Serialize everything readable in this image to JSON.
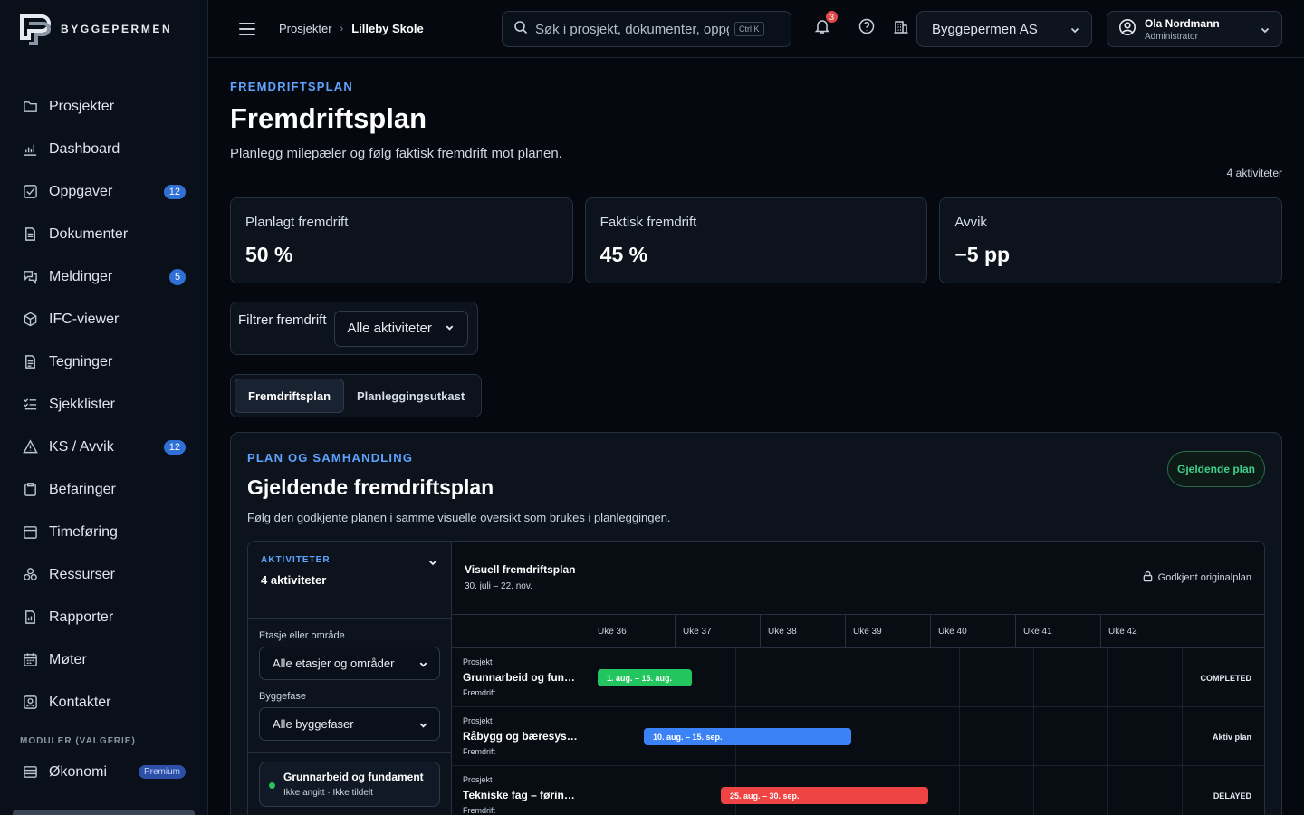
{
  "brand": {
    "name": "BYGGEPERMEN"
  },
  "sidebar": {
    "items": [
      {
        "label": "Prosjekter",
        "icon": "folder-icon"
      },
      {
        "label": "Dashboard",
        "icon": "chart-icon"
      },
      {
        "label": "Oppgaver",
        "icon": "checkbox-icon",
        "badge": "12"
      },
      {
        "label": "Dokumenter",
        "icon": "document-icon"
      },
      {
        "label": "Meldinger",
        "icon": "messages-icon",
        "badge": "5"
      },
      {
        "label": "IFC-viewer",
        "icon": "cube-icon"
      },
      {
        "label": "Tegninger",
        "icon": "drawing-icon"
      },
      {
        "label": "Sjekklister",
        "icon": "checklist-icon"
      },
      {
        "label": "KS / Avvik",
        "icon": "warning-icon",
        "badge": "12"
      },
      {
        "label": "Befaringer",
        "icon": "clipboard-icon"
      },
      {
        "label": "Timeføring",
        "icon": "timesheet-icon"
      },
      {
        "label": "Ressurser",
        "icon": "resources-icon"
      },
      {
        "label": "Rapporter",
        "icon": "report-icon"
      },
      {
        "label": "Møter",
        "icon": "calendar-icon"
      },
      {
        "label": "Kontakter",
        "icon": "contacts-icon"
      }
    ],
    "modules_label": "MODULER (VALGFRIE)",
    "modules": [
      {
        "label": "Økonomi",
        "icon": "economy-icon",
        "tag": "Premium"
      }
    ]
  },
  "topbar": {
    "breadcrumb": [
      "Prosjekter",
      "Lilleby Skole"
    ],
    "search_placeholder": "Søk i prosjekt, dokumenter, oppgaver...",
    "search_shortcut": "Ctrl K",
    "notifications": "3",
    "company": "Byggepermen AS",
    "user_name": "Ola Nordmann",
    "user_role": "Administrator"
  },
  "page": {
    "eyebrow": "FREMDRIFTSPLAN",
    "title": "Fremdriftsplan",
    "subtitle": "Planlegg milepæler og følg faktisk fremdrift mot planen.",
    "activity_count": "4 aktiviteter",
    "stats": [
      {
        "label": "Planlagt fremdrift",
        "value": "50 %"
      },
      {
        "label": "Faktisk fremdrift",
        "value": "45 %"
      },
      {
        "label": "Avvik",
        "value": "−5 pp"
      }
    ],
    "filter_label": "Filtrer fremdrift",
    "filter_value": "Alle aktiviteter",
    "tabs": [
      "Fremdriftsplan",
      "Planleggingsutkast"
    ]
  },
  "panel": {
    "eyebrow": "PLAN OG SAMHANDLING",
    "title": "Gjeldende fremdriftsplan",
    "subtitle": "Følg den godkjente planen i samme visuelle oversikt som brukes i planleggingen.",
    "status_pill": "Gjeldende plan",
    "left": {
      "eyebrow": "AKTIVITETER",
      "count": "4 aktiviteter",
      "floor_label": "Etasje eller område",
      "floor_value": "Alle etasjer og områder",
      "phase_label": "Byggefase",
      "phase_value": "Alle byggefaser",
      "card_title": "Grunnarbeid og fundament",
      "card_sub": "Ikke angitt · Ikke tildelt"
    },
    "gantt": {
      "title": "Visuell fremdriftsplan",
      "range": "30. juli – 22. nov.",
      "lock_label": "Godkjent originalplan",
      "weeks": [
        "Uke 36",
        "Uke 37",
        "Uke 38",
        "Uke 39",
        "Uke 40",
        "Uke 41",
        "Uke 42"
      ],
      "rows": [
        {
          "project": "Prosjekt",
          "name": "Grunnarbeid og fundament",
          "phase": "Fremdrift",
          "bar_label": "1. aug. – 15. aug.",
          "color": "#22c55e",
          "status": "COMPLETED"
        },
        {
          "project": "Prosjekt",
          "name": "Råbygg og bæresystem",
          "phase": "Fremdrift",
          "bar_label": "10. aug. – 15. sep.",
          "color": "#3b82f6",
          "status": "Aktiv plan"
        },
        {
          "project": "Prosjekt",
          "name": "Tekniske fag – føringer",
          "phase": "Fremdrift",
          "bar_label": "25. aug. – 30. sep.",
          "color": "#ef4444",
          "status": "DELAYED"
        }
      ]
    }
  }
}
